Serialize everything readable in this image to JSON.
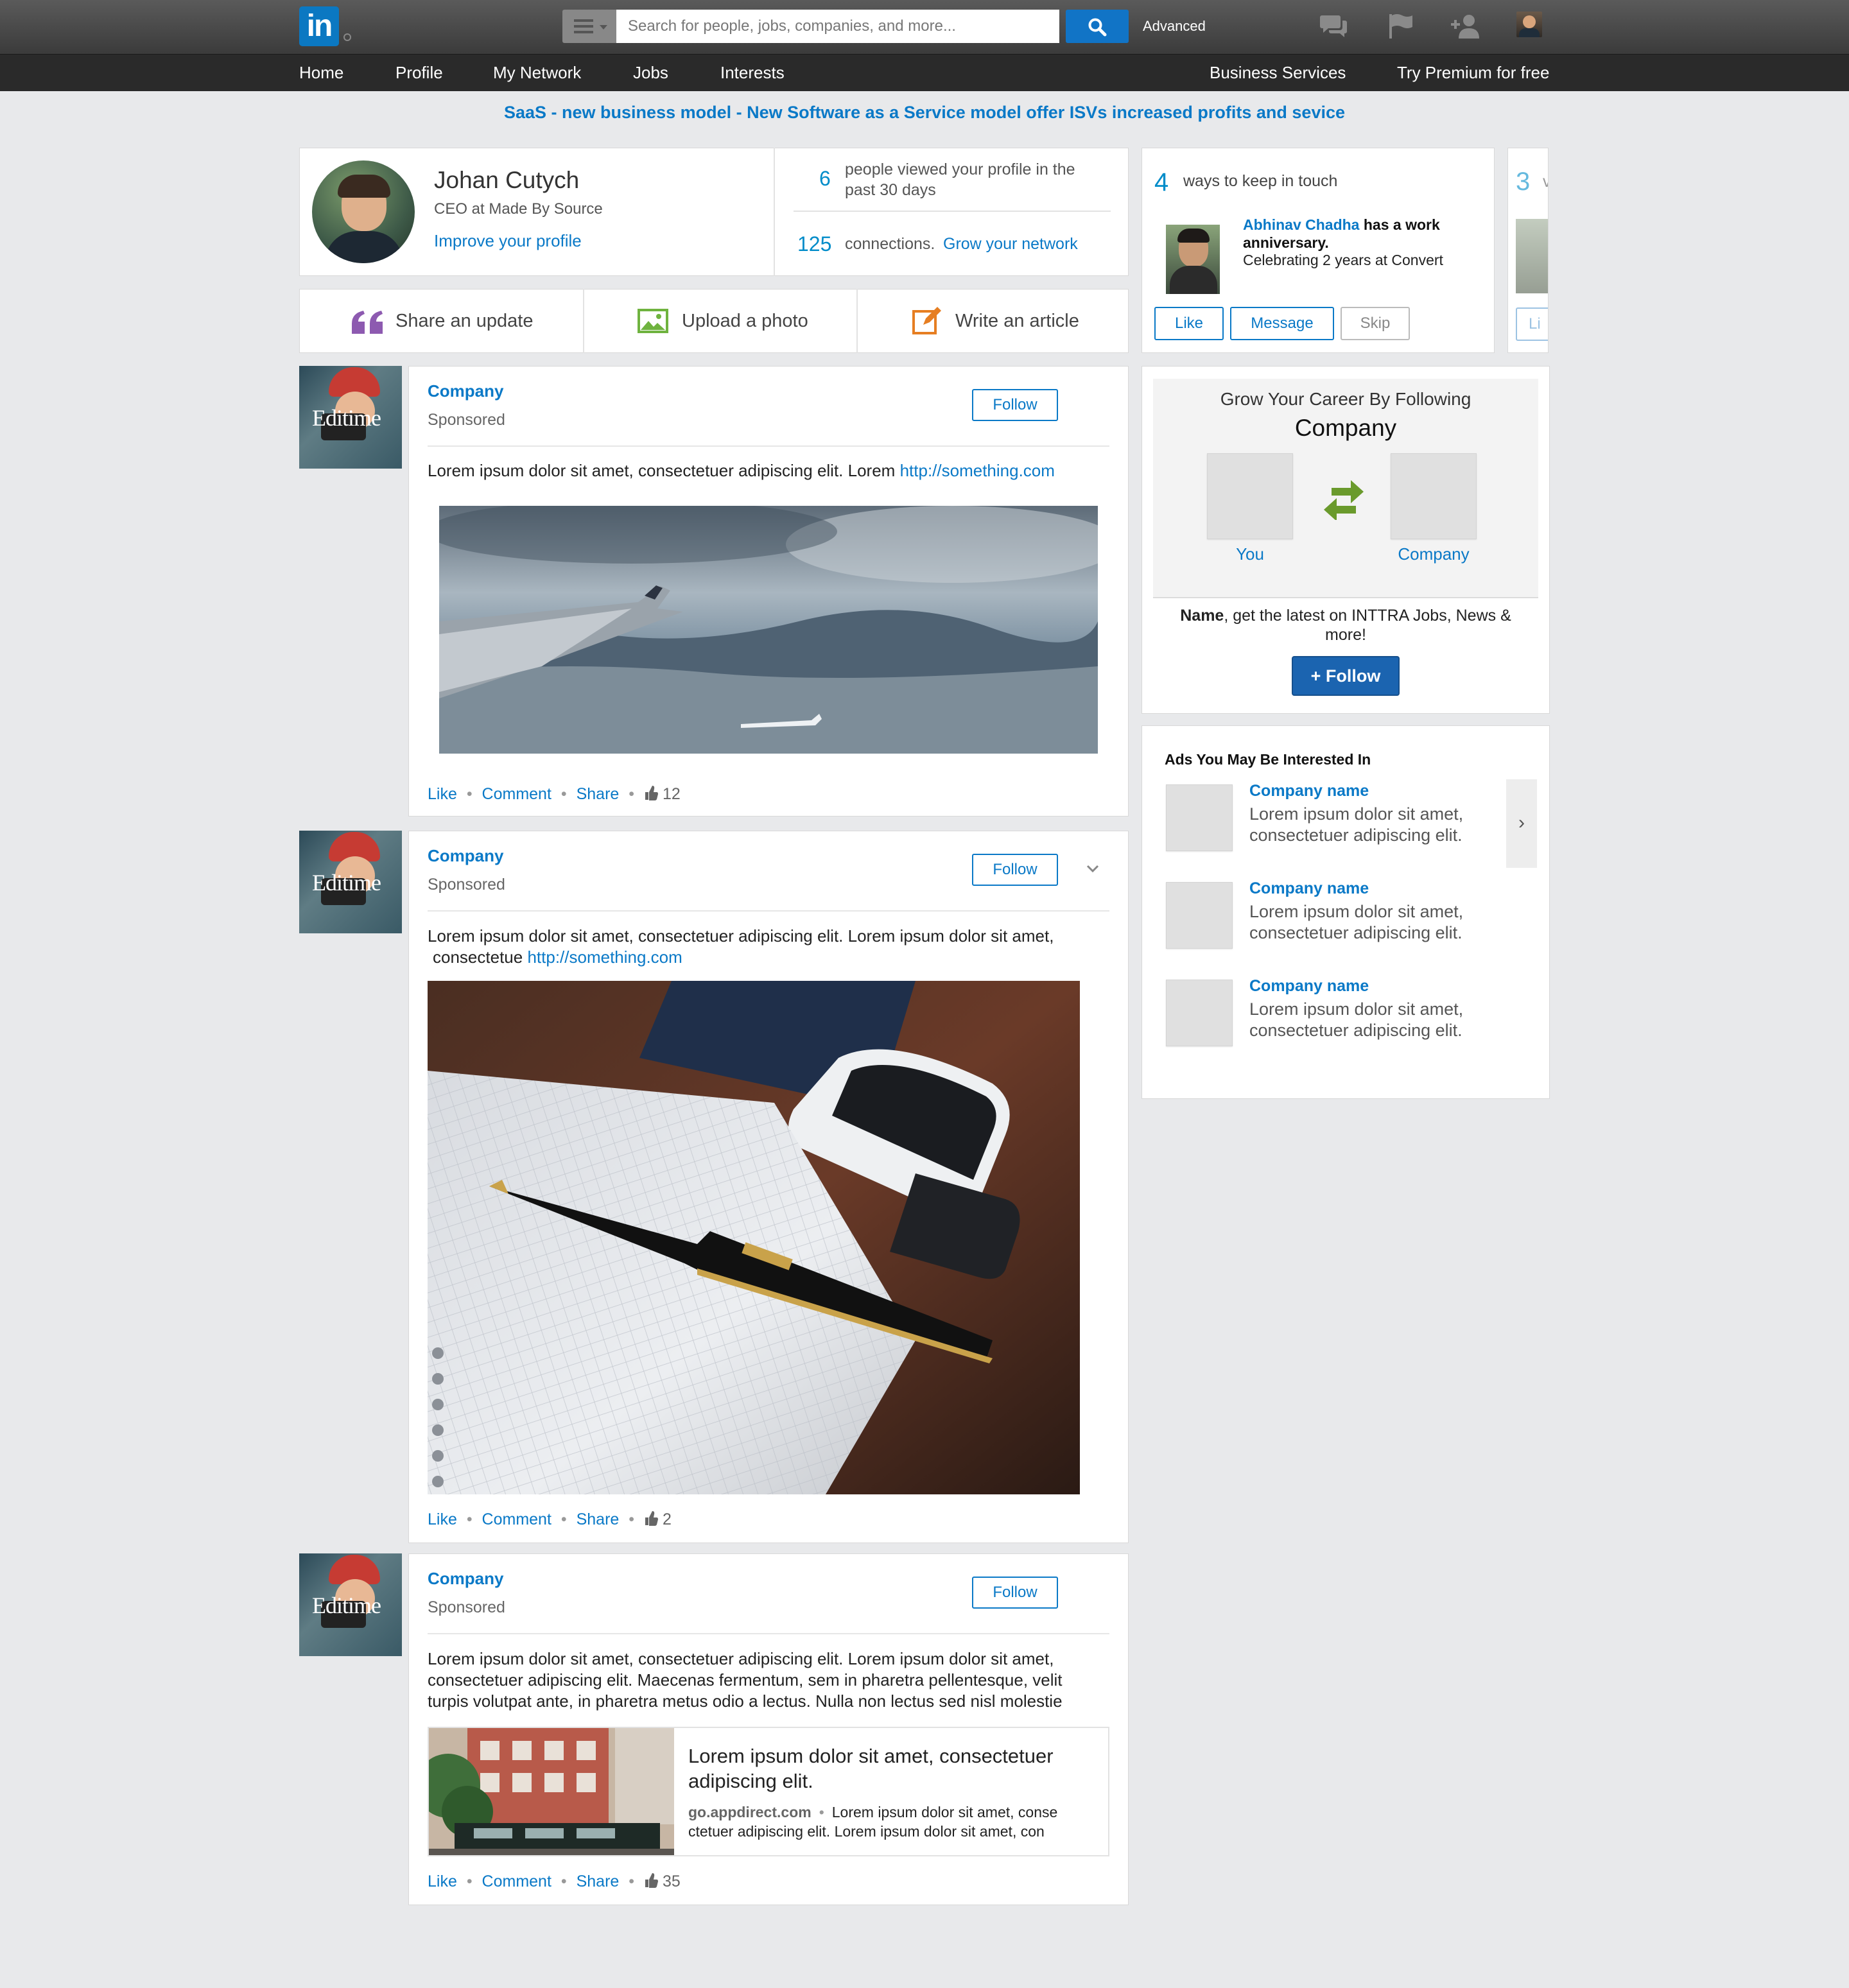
{
  "topbar": {
    "logo": "in",
    "search_placeholder": "Search for people, jobs, companies, and more...",
    "advanced": "Advanced"
  },
  "nav": {
    "items": [
      "Home",
      "Profile",
      "My Network",
      "Jobs",
      "Interests"
    ],
    "right": [
      "Business Services",
      "Try Premium for free"
    ]
  },
  "promo": "SaaS - new business model - New Software as a Service model offer ISVs increased profits and sevice",
  "profile": {
    "name": "Johan Cutych",
    "title": "CEO at Made By Source",
    "improve": "Improve your profile",
    "views_count": "6",
    "views_text": "people viewed your profile in the past 30 days",
    "connections_count": "125",
    "connections_text": "connections.",
    "grow": "Grow your network"
  },
  "share": {
    "update": "Share an update",
    "photo": "Upload a photo",
    "article": "Write an article"
  },
  "keep_in_touch": {
    "count": "4",
    "text": "ways to keep in touch",
    "person": "Abhinav Chadha",
    "event": "has a work anniversary.",
    "detail": "Celebrating 2 years at Convert",
    "like": "Like",
    "message": "Message",
    "skip": "Skip",
    "next_count": "3",
    "next_letter": "v",
    "next_like": "Li"
  },
  "posts": [
    {
      "company": "Company",
      "sponsored": "Sponsored",
      "follow": "Follow",
      "text": "Lorem ipsum dolor sit amet, consectetuer adipiscing elit. Lorem",
      "url": "http://something.com",
      "like": "Like",
      "comment": "Comment",
      "share": "Share",
      "likes": "12"
    },
    {
      "company": "Company",
      "sponsored": "Sponsored",
      "follow": "Follow",
      "text_line1": "Lorem ipsum dolor sit amet, consectetuer adipiscing elit. Lorem ipsum dolor sit amet,",
      "text_line2": "consectetue",
      "url": "http://something.com",
      "like": "Like",
      "comment": "Comment",
      "share": "Share",
      "likes": "2"
    },
    {
      "company": "Company",
      "sponsored": "Sponsored",
      "follow": "Follow",
      "text_line1": "Lorem ipsum dolor sit amet, consectetuer adipiscing elit. Lorem ipsum dolor sit amet,",
      "text_line2": "consectetuer adipiscing elit. Maecenas fermentum, sem in pharetra pellentesque, velit",
      "text_line3": "turpis volutpat ante, in pharetra metus odio a lectus. Nulla non lectus sed nisl molestie",
      "link_title": "Lorem ipsum dolor sit amet, consectetuer adipiscing elit.",
      "link_domain": "go.appdirect.com",
      "link_desc_1": "Lorem ipsum dolor sit amet, conse",
      "link_desc_2": "ctetuer adipiscing elit. Lorem ipsum dolor sit amet, con",
      "like": "Like",
      "comment": "Comment",
      "share": "Share",
      "likes": "35"
    }
  ],
  "avatar_text": "Editime",
  "follow_card": {
    "heading": "Grow Your Career By Following",
    "company": "Company",
    "you": "You",
    "company_label": "Company",
    "name": "Name",
    "text": ", get the latest on INTTRA Jobs, News &",
    "text2": "more!",
    "button": "+ Follow"
  },
  "ads": {
    "heading": "Ads You May Be Interested In",
    "items": [
      {
        "name": "Company name",
        "desc1": "Lorem ipsum dolor sit amet,",
        "desc2": "consectetuer adipiscing elit."
      },
      {
        "name": "Company name",
        "desc1": "Lorem ipsum dolor sit amet,",
        "desc2": "consectetuer adipiscing elit."
      },
      {
        "name": "Company name",
        "desc1": "Lorem ipsum dolor sit amet,",
        "desc2": "consectetuer adipiscing elit."
      }
    ],
    "arrow": "›"
  },
  "colors": {
    "accent": "#0a79c7",
    "follow_button": "#1b64b0",
    "page_bg": "#e8e9eb"
  }
}
